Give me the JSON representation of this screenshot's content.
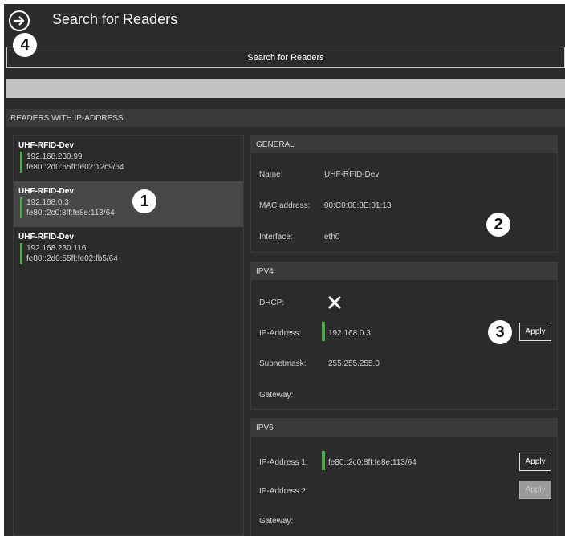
{
  "header": {
    "title": "Search for Readers",
    "back_icon": "arrow-right-circle-icon"
  },
  "toolbar": {
    "search_label": "Search for Readers"
  },
  "progress": {
    "value": 1.0
  },
  "readers_section": {
    "title": "READERS WITH IP-ADDRESS",
    "items": [
      {
        "name": "UHF-RFID-Dev",
        "ip": "192.168.230.99",
        "ipv6": "fe80::2d0:55ff:fe02:12c9/64"
      },
      {
        "name": "UHF-RFID-Dev",
        "ip": "192.168.0.3",
        "ipv6": "fe80::2c0:8ff:fe8e:113/64"
      },
      {
        "name": "UHF-RFID-Dev",
        "ip": "192.168.230.116",
        "ipv6": "fe80::2d0:55ff:fe02:fb5/64"
      }
    ]
  },
  "general": {
    "title": "GENERAL",
    "name_label": "Name:",
    "name_value": "UHF-RFID-Dev",
    "mac_label": "MAC address:",
    "mac_value": "00:C0:08:8E:01:13",
    "interface_label": "Interface:",
    "interface_value": "eth0"
  },
  "ipv4": {
    "title": "IPV4",
    "dhcp_label": "DHCP:",
    "dhcp_icon": "close-x-icon",
    "ip_label": "IP-Address:",
    "ip_value": "192.168.0.3",
    "apply_label": "Apply",
    "subnet_label": "Subnetmask:",
    "subnet_value": "255.255.255.0",
    "gateway_label": "Gateway:"
  },
  "ipv6": {
    "title": "IPV6",
    "ip1_label": "IP-Address 1:",
    "ip1_value": "fe80::2c0:8ff:fe8e:113/64",
    "apply1_label": "Apply",
    "ip2_label": "IP-Address 2:",
    "apply2_label": "Apply",
    "gateway_label": "Gateway:"
  },
  "callouts": [
    "1",
    "2",
    "3",
    "4"
  ],
  "colors": {
    "background": "#2b2b2b",
    "header": "#3a3a3a",
    "selected": "#474747",
    "status_green": "#4ea84e",
    "progress": "#c2c2c2"
  }
}
